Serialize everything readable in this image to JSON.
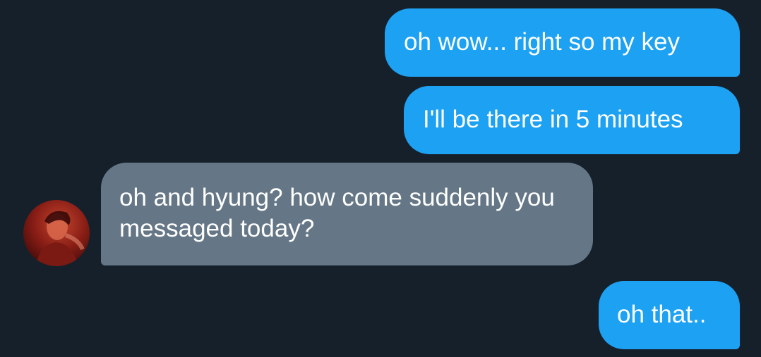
{
  "conversation": {
    "messages": [
      {
        "sender": "me",
        "text": "oh wow... right so my key"
      },
      {
        "sender": "me",
        "text": "I'll be there in 5 minutes"
      },
      {
        "sender": "contact",
        "text": "oh and hyung? how come suddenly you messaged today?"
      },
      {
        "sender": "me",
        "text": "oh that.."
      }
    ],
    "contact": {
      "avatar_icon": "user-photo-avatar"
    }
  },
  "colors": {
    "background": "#16202b",
    "sent_bubble": "#1da1f2",
    "received_bubble": "#657786",
    "text": "#ffffff"
  }
}
